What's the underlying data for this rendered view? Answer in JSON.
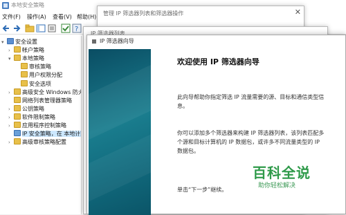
{
  "main": {
    "title": "本地安全策略",
    "menu": [
      "文件(F)",
      "操作(A)",
      "查看(V)",
      "帮助(H)"
    ]
  },
  "tree": {
    "items": [
      {
        "label": "安全设置",
        "indent": 0,
        "icon": "shield-icon",
        "chevron": "▾"
      },
      {
        "label": "帐户策略",
        "indent": 1,
        "icon": "folder-icon",
        "chevron": "›"
      },
      {
        "label": "本地策略",
        "indent": 1,
        "icon": "folder-icon",
        "chevron": "▾"
      },
      {
        "label": "审核策略",
        "indent": 2,
        "icon": "folder-icon",
        "chevron": ""
      },
      {
        "label": "用户权限分配",
        "indent": 2,
        "icon": "folder-icon",
        "chevron": ""
      },
      {
        "label": "安全选项",
        "indent": 2,
        "icon": "folder-icon",
        "chevron": ""
      },
      {
        "label": "高级安全 Windows 防火墙",
        "indent": 1,
        "icon": "folder-icon",
        "chevron": "›"
      },
      {
        "label": "网络列表管理器策略",
        "indent": 1,
        "icon": "folder-icon",
        "chevron": ""
      },
      {
        "label": "公钥策略",
        "indent": 1,
        "icon": "folder-icon",
        "chevron": "›"
      },
      {
        "label": "软件限制策略",
        "indent": 1,
        "icon": "folder-icon",
        "chevron": "›"
      },
      {
        "label": "应用程序控制策略",
        "indent": 1,
        "icon": "folder-icon",
        "chevron": "›"
      },
      {
        "label": "IP 安全策略，在 本地计算机",
        "indent": 1,
        "icon": "network-icon",
        "chevron": "",
        "selected": true
      },
      {
        "label": "高级审核策略配置",
        "indent": 1,
        "icon": "folder-icon",
        "chevron": "›"
      }
    ]
  },
  "bg_dialog": {
    "title": "管理 IP 筛选器列表和筛选器操作",
    "close": "✕"
  },
  "mid_dialog": {
    "title": "IP 筛选器列表"
  },
  "wizard": {
    "title": "IP 筛选器向导",
    "heading": "欢迎使用 IP 筛选器向导",
    "para1": "此向导帮助你指定筛选 IP 流量需要的源、目标和通信类型信息。",
    "para2": "你可以添加多个筛选器来构建 IP 筛选器列表，该列表匹配多个源和目标计算机的 IP 数据包，或许多不同流量类型的 IP 数据包。",
    "para3": "单击“下一步”继续。"
  },
  "watermark": {
    "main": "百科全说",
    "sub": "助你轻松解决"
  },
  "colors": {
    "banner": "#1a7d8e",
    "selected": "#cce8ff",
    "watermark": "#2f9a4a"
  }
}
